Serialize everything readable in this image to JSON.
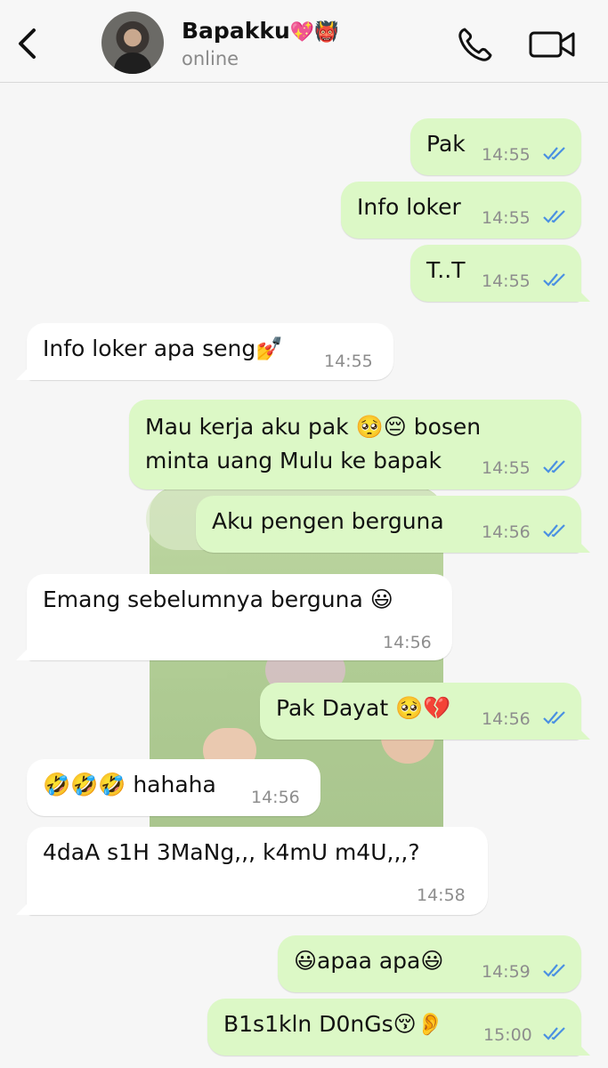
{
  "header": {
    "contact_name": "Bapakku",
    "name_emoji": "💖👹",
    "status": "online"
  },
  "icons": {
    "back": "chevron-left-icon",
    "call": "phone-icon",
    "video": "video-camera-icon",
    "read_receipt": "double-check-icon"
  },
  "colors": {
    "outgoing_bubble": "#dcf8c6",
    "incoming_bubble": "#ffffff",
    "read_tick": "#4a90e2",
    "timestamp": "#8d8d8d"
  },
  "messages": [
    {
      "direction": "out",
      "text": "Pak",
      "time": "14:55",
      "read": true
    },
    {
      "direction": "out",
      "text": "Info loker",
      "time": "14:55",
      "read": true
    },
    {
      "direction": "out",
      "text": "T..T",
      "time": "14:55",
      "read": true
    },
    {
      "direction": "in",
      "text": "Info loker apa seng💅",
      "time": "14:55"
    },
    {
      "direction": "out",
      "text_line1": "Mau kerja aku pak 🥺😔 bosen",
      "text_line2": "minta uang Mulu ke bapak",
      "time": "14:55",
      "read": true
    },
    {
      "direction": "out",
      "text": "Aku pengen berguna",
      "time": "14:56",
      "read": true
    },
    {
      "direction": "in",
      "text": "Emang sebelumnya berguna 😃",
      "time": "14:56"
    },
    {
      "direction": "out",
      "text": "Pak Dayat 🥺💔",
      "time": "14:56",
      "read": true
    },
    {
      "direction": "in",
      "text": "🤣🤣🤣 hahaha",
      "time": "14:56"
    },
    {
      "direction": "in",
      "text": "4daA s1H 3MaNg,,, k4mU m4U,,,?",
      "time": "14:58"
    },
    {
      "direction": "out",
      "text": "😃apaa apa😃",
      "time": "14:59",
      "read": true
    },
    {
      "direction": "out",
      "text": "B1s1kln D0nGs😚👂",
      "time": "15:00",
      "read": true
    }
  ]
}
